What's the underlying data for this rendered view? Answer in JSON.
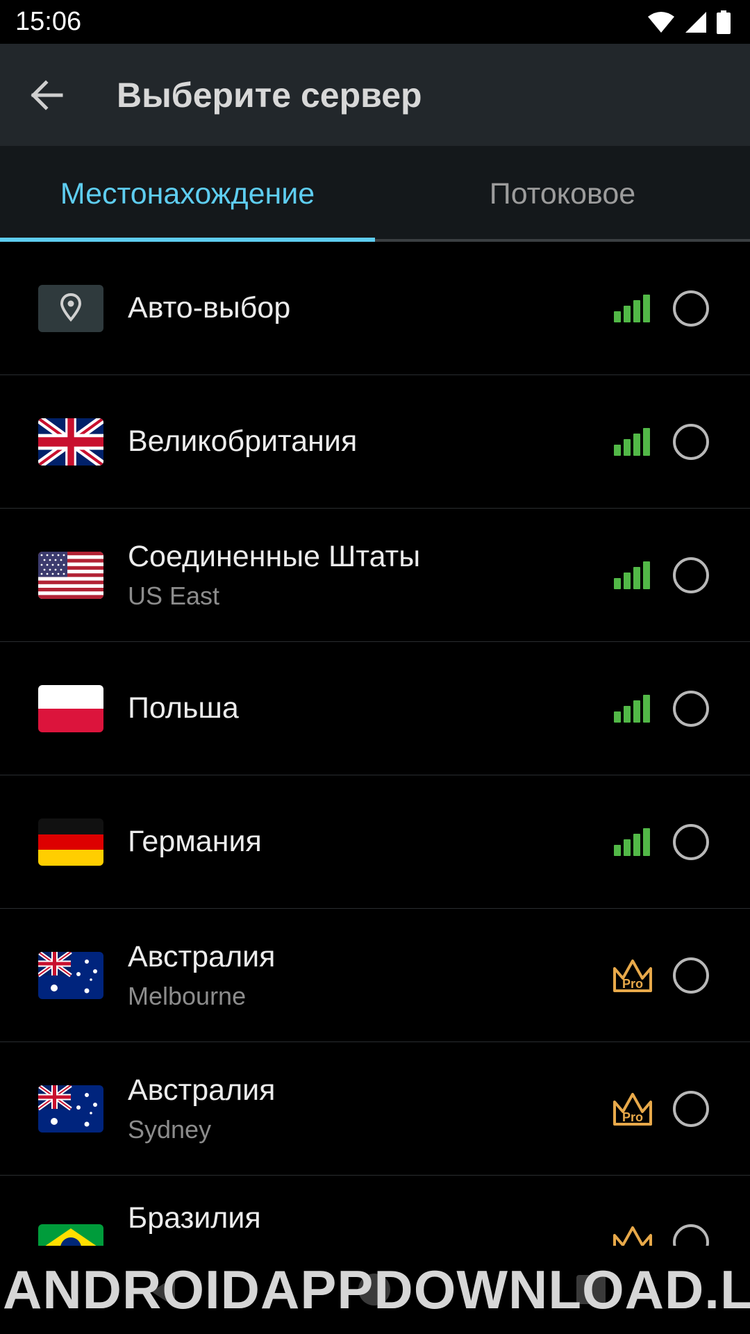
{
  "status_bar": {
    "time": "15:06"
  },
  "app_bar": {
    "title": "Выберите сервер"
  },
  "tabs": [
    {
      "label": "Местонахождение",
      "active": true
    },
    {
      "label": "Потоковое",
      "active": false
    }
  ],
  "servers": [
    {
      "name": "Авто-выбор",
      "sub": "",
      "flag": "auto",
      "badge": "signal"
    },
    {
      "name": "Великобритания",
      "sub": "",
      "flag": "uk",
      "badge": "signal"
    },
    {
      "name": "Соединенные Штаты",
      "sub": "US East",
      "flag": "us",
      "badge": "signal"
    },
    {
      "name": "Польша",
      "sub": "",
      "flag": "pl",
      "badge": "signal"
    },
    {
      "name": "Германия",
      "sub": "",
      "flag": "de",
      "badge": "signal"
    },
    {
      "name": "Австралия",
      "sub": "Melbourne",
      "flag": "au",
      "badge": "pro"
    },
    {
      "name": "Австралия",
      "sub": "Sydney",
      "flag": "au",
      "badge": "pro"
    },
    {
      "name": "Бразилия",
      "sub": "",
      "flag": "br",
      "badge": "pro"
    }
  ],
  "pro_label": "Pro",
  "watermark": "ANDROIDAPPDOWNLOAD.LINK",
  "colors": {
    "accent": "#5ecdf0",
    "signal": "#52b847",
    "pro": "#e8a94a",
    "app_bar": "#22272b"
  }
}
